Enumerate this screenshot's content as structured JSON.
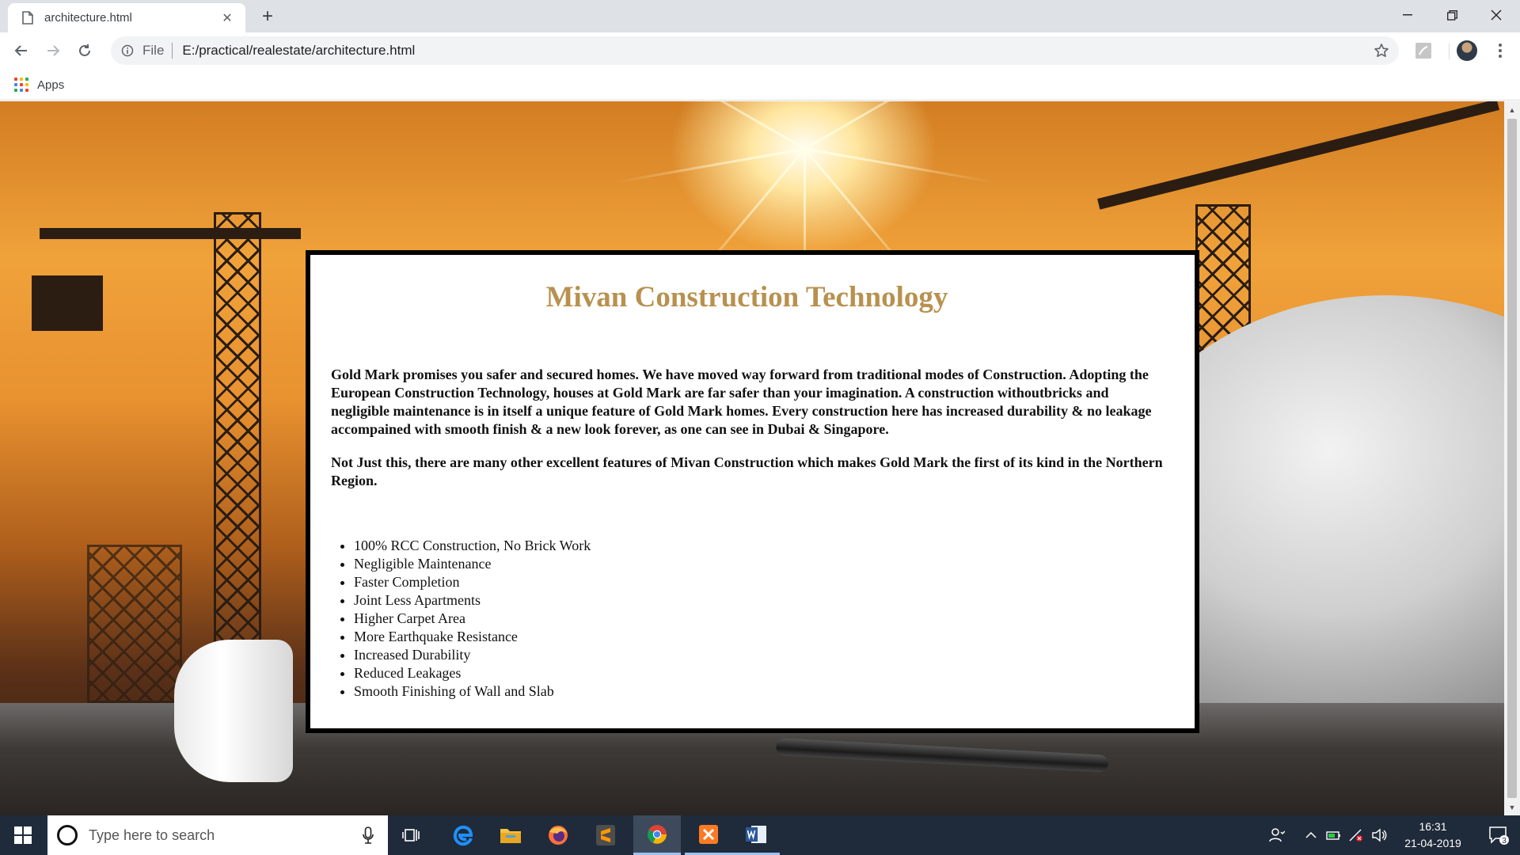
{
  "browser": {
    "tab": {
      "title": "architecture.html",
      "doc_icon": "document-icon",
      "close_icon": "close-icon"
    },
    "new_tab_icon": "plus-icon",
    "window_controls": [
      "minimize-icon",
      "restore-icon",
      "close-icon"
    ],
    "nav": {
      "back_icon": "arrow-left-icon",
      "forward_icon": "arrow-right-icon",
      "reload_icon": "reload-icon"
    },
    "address": {
      "scheme_label": "File",
      "url": "E:/practical/realestate/architecture.html",
      "info_icon": "info-icon",
      "star_icon": "star-icon"
    },
    "bookmarks": {
      "apps_label": "Apps"
    },
    "colors": {
      "tabstrip": "#dee1e6",
      "omnibox": "#f1f3f4"
    }
  },
  "page": {
    "title": "Mivan Construction Technology",
    "title_color": "#b8914f",
    "paragraphs": [
      "Gold Mark promises you safer and secured homes. We have moved way forward from traditional modes of Construction. Adopting the European Construction Technology, houses at Gold Mark are far safer than your imagination. A construction withoutbricks and negligible maintenance is in itself a unique feature of Gold Mark homes. Every construction here has increased durability & no leakage accompained with smooth finish & a new look forever, as one can see in Dubai & Singapore.",
      "Not Just this, there are many other excellent features of Mivan Construction which makes Gold Mark the first of its kind in the Northern Region."
    ],
    "features": [
      "100% RCC Construction, No Brick Work",
      "Negligible Maintenance",
      "Faster Completion",
      "Joint Less Apartments",
      "Higher Carpet Area",
      "More Earthquake Resistance",
      "Increased Durability",
      "Reduced Leakages",
      "Smooth Finishing of Wall and Slab"
    ]
  },
  "taskbar": {
    "search_placeholder": "Type here to search",
    "apps": [
      "task-view-icon",
      "edge-icon",
      "file-explorer-icon",
      "firefox-icon",
      "sublime-text-icon",
      "chrome-icon",
      "xampp-icon",
      "word-icon"
    ],
    "clock": {
      "time": "16:31",
      "date": "21-04-2019"
    },
    "notification_count": "3",
    "colors": {
      "taskbar": "#1f2b3a"
    }
  }
}
